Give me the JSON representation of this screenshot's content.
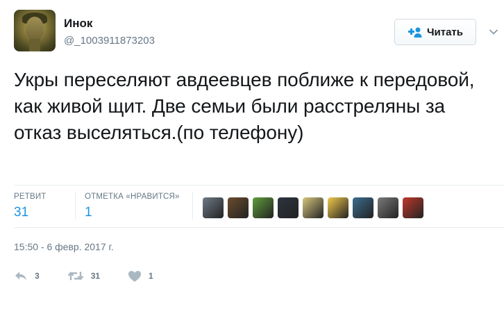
{
  "user": {
    "name": "Инок",
    "handle": "@_1003911873203",
    "follow_label": "Читать"
  },
  "tweet": {
    "text": "Укры переселяют авдеевцев поближе к передовой, как живой щит. Две семьи были расстреляны за отказ выселяться.(по телефону)",
    "timestamp": "15:50 - 6 февр. 2017 г."
  },
  "stats": {
    "retweets_label": "РЕТВИТ",
    "retweets_value": "31",
    "likes_label": "ОТМЕТКА «НРАВИТСЯ»",
    "likes_value": "1"
  },
  "likers": [
    {
      "icon": "avatar-newspaper",
      "color": "#6e7a86"
    },
    {
      "icon": "avatar-cat",
      "color": "#6b4c2e"
    },
    {
      "icon": "avatar-frog",
      "color": "#5f9e3b"
    },
    {
      "icon": "avatar-officer",
      "color": "#2c3440"
    },
    {
      "icon": "avatar-beach",
      "color": "#d7c67e"
    },
    {
      "icon": "avatar-sunflower",
      "color": "#f2c94c"
    },
    {
      "icon": "avatar-blue-face",
      "color": "#3c6d8f"
    },
    {
      "icon": "avatar-man",
      "color": "#7a7a7a"
    },
    {
      "icon": "avatar-cccp",
      "color": "#c0392b"
    }
  ],
  "actions": {
    "reply_count": "3",
    "retweet_count": "31",
    "like_count": "1"
  },
  "colors": {
    "accent": "#1b95e0",
    "muted": "#657786",
    "divider": "#e6ecf0"
  }
}
